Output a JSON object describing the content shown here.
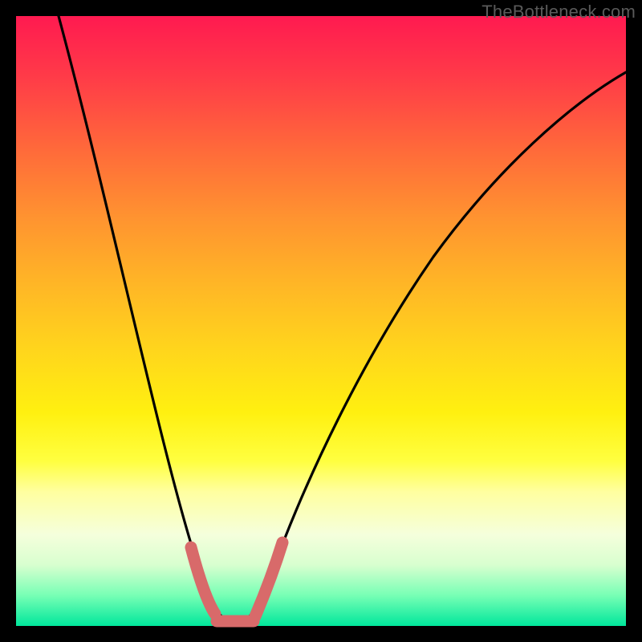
{
  "watermark": "TheBottleneck.com",
  "colors": {
    "background": "#000000",
    "curve": "#000000",
    "valley_marker": "#d86a6a"
  },
  "chart_data": {
    "type": "line",
    "title": "",
    "xlabel": "",
    "ylabel": "",
    "xlim": [
      0,
      100
    ],
    "ylim": [
      0,
      100
    ],
    "series": [
      {
        "name": "bottleneck-curve",
        "x": [
          7,
          10,
          14,
          18,
          22,
          25,
          28,
          30,
          32,
          34,
          36,
          38,
          40,
          44,
          48,
          54,
          60,
          68,
          76,
          84,
          92,
          100
        ],
        "values": [
          100,
          88,
          74,
          60,
          45,
          33,
          21,
          12,
          6,
          2,
          0,
          0,
          2,
          7,
          15,
          26,
          38,
          50,
          60,
          68,
          74,
          79
        ]
      }
    ],
    "annotations": [
      {
        "kind": "valley-marker",
        "x_range": [
          30,
          40
        ],
        "y": 0
      }
    ],
    "gradient_stops": [
      {
        "pos": 0.0,
        "color": "#ff1a50"
      },
      {
        "pos": 0.65,
        "color": "#fff010"
      },
      {
        "pos": 0.9,
        "color": "#d8ffcf"
      },
      {
        "pos": 1.0,
        "color": "#00e69b"
      }
    ]
  }
}
